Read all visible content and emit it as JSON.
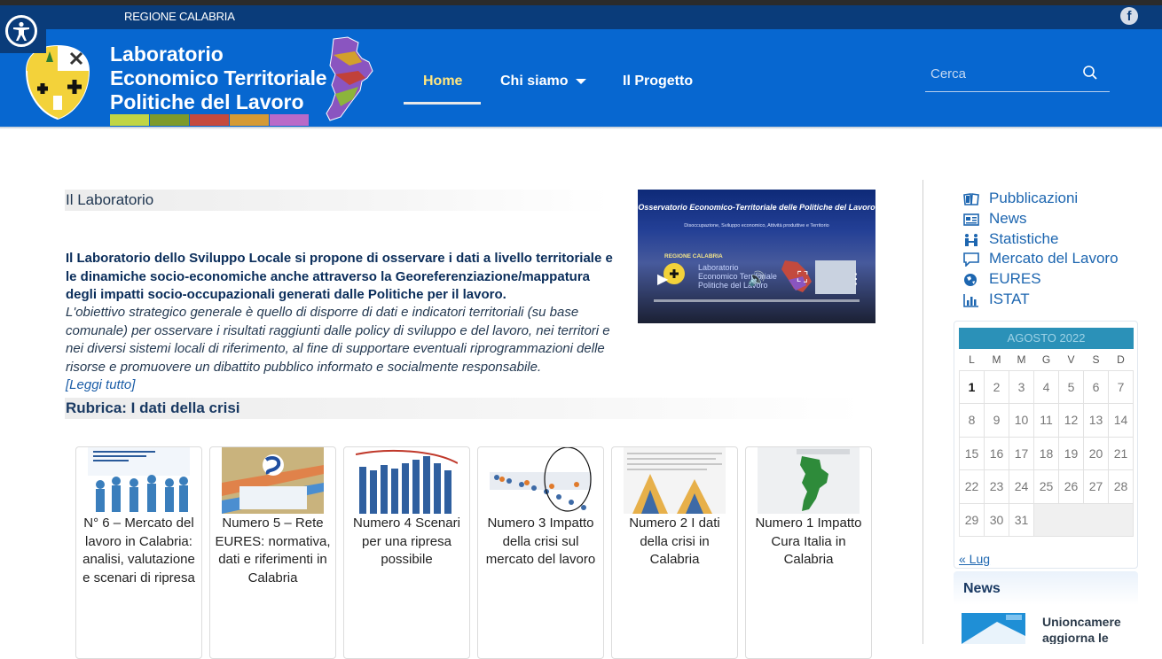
{
  "region_bar": {
    "label": "REGIONE CALABRIA",
    "facebook_icon": "f"
  },
  "brand": {
    "line1": "Laboratorio",
    "line2": "Economico Territoriale",
    "line3": "Politiche del Lavoro",
    "bar_colors": [
      "#c0d545",
      "#7d9a2b",
      "#c54a3d",
      "#d59a35",
      "#b96ac8"
    ]
  },
  "nav": {
    "home": "Home",
    "chi_siamo": "Chi siamo",
    "progetto": "Il Progetto"
  },
  "search": {
    "placeholder": "Cerca"
  },
  "main": {
    "section1_title": "Il Laboratorio",
    "intro_bold": "Il Laboratorio dello Sviluppo Locale si propone di osservare i dati a livello territoriale e le dinamiche socio-economiche anche attraverso la Georeferenziazione/mappatura degli impatti socio-occupazionali generati dalle Politiche per il lavoro.",
    "intro_italic": "L'obiettivo strategico generale è quello di disporre di dati e indicatori territoriali (su base comunale) per osservare i risultati raggiunti dalle policy di sviluppo e del lavoro, nei territori e nei diversi sistemi locali di riferimento, al fine di supportare eventuali riprogrammazioni delle risorse e promuovere un dibattito pubblico informato e socialmente responsabile.",
    "read_more": "[Leggi tutto]",
    "section2_title": "Rubrica: I dati della crisi"
  },
  "video": {
    "title": "Osservatorio Economico-Territoriale delle Politiche del Lavoro",
    "subtitle": "Disoccupazione, Sviluppo economico, Attività produttive e Territorio",
    "region": "REGIONE CALABRIA",
    "overlay": "Laboratorio Economico Territoriale Politiche del Lavoro"
  },
  "cards": [
    {
      "caption": "N° 6 – Mercato del lavoro in Calabria: analisi, valutazione e scenari di ripresa"
    },
    {
      "caption": "Numero 5 – Rete EURES: normativa, dati e riferimenti in Calabria"
    },
    {
      "caption": "Numero 4 Scenari per una ripresa possibile"
    },
    {
      "caption": "Numero 3 Impatto della crisi sul mercato del lavoro"
    },
    {
      "caption": "Numero 2 I dati della crisi in Calabria"
    },
    {
      "caption": "Numero 1 Impatto Cura Italia in Calabria"
    }
  ],
  "sidebar": {
    "links": [
      {
        "label": "Pubblicazioni",
        "icon": "book-icon"
      },
      {
        "label": "News",
        "icon": "newspaper-icon"
      },
      {
        "label": "Statistiche",
        "icon": "people-stats-icon"
      },
      {
        "label": "Mercato del Lavoro",
        "icon": "comment-icon"
      },
      {
        "label": "EURES",
        "icon": "globe-icon"
      },
      {
        "label": "ISTAT",
        "icon": "bar-chart-icon"
      }
    ],
    "calendar": {
      "month": "AGOSTO 2022",
      "weekdays": [
        "L",
        "M",
        "M",
        "G",
        "V",
        "S",
        "D"
      ],
      "weeks": [
        [
          "1",
          "2",
          "3",
          "4",
          "5",
          "6",
          "7"
        ],
        [
          "8",
          "9",
          "10",
          "11",
          "12",
          "13",
          "14"
        ],
        [
          "15",
          "16",
          "17",
          "18",
          "19",
          "20",
          "21"
        ],
        [
          "22",
          "23",
          "24",
          "25",
          "26",
          "27",
          "28"
        ],
        [
          "29",
          "30",
          "31",
          "",
          "",
          "",
          ""
        ]
      ],
      "prev": "« Lug"
    },
    "news_title": "News",
    "news_item": "Unioncamere aggiorna le"
  }
}
